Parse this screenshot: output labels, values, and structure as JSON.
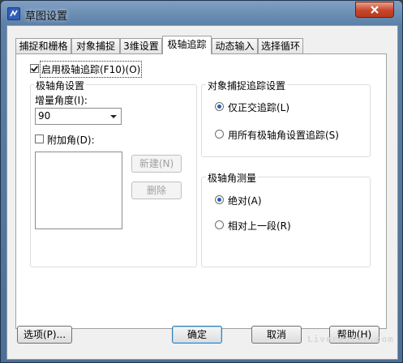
{
  "window": {
    "title": "草图设置",
    "title_icon": "app-logo-icon",
    "close_icon": "close-x-icon"
  },
  "tabs": [
    {
      "label": "捕捉和栅格",
      "active": false
    },
    {
      "label": "对象捕捉",
      "active": false
    },
    {
      "label": "3维设置",
      "active": false
    },
    {
      "label": "极轴追踪",
      "active": true
    },
    {
      "label": "动态输入",
      "active": false
    },
    {
      "label": "选择循环",
      "active": false
    }
  ],
  "polar": {
    "enable_label": "启用极轴追踪(F10)(O)",
    "enable_checked": true,
    "angle_settings": {
      "title": "极轴角设置",
      "increment_label": "增量角度(I):",
      "increment_value": "90",
      "additional_label": "附加角(D):",
      "additional_checked": false,
      "new_button": "新建(N)",
      "delete_button": "删除"
    },
    "snap_tracking": {
      "title": "对象捕捉追踪设置",
      "orthogonal": "仅正交追踪(L)",
      "all_polar": "用所有极轴角设置追踪(S)",
      "selected": "orthogonal"
    },
    "measurement": {
      "title": "极轴角测量",
      "absolute": "绝对(A)",
      "relative": "相对上一段(R)",
      "selected": "absolute"
    }
  },
  "footer": {
    "options_button": "选项(P)...",
    "ok_button": "确定",
    "cancel_button": "取消",
    "help_button": "帮助(H)"
  },
  "watermark": "Liverenter.com"
}
